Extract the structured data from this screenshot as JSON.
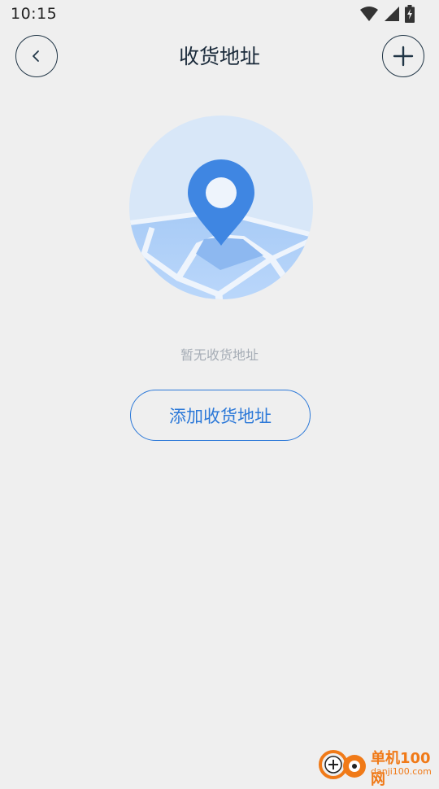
{
  "status_bar": {
    "time": "10:15",
    "icons": [
      "wifi-icon",
      "signal-icon",
      "battery-icon"
    ]
  },
  "header": {
    "title": "收货地址",
    "back_icon": "chevron-left-icon",
    "add_icon": "plus-icon"
  },
  "empty_state": {
    "illustration": "map-pin-icon",
    "message": "暂无收货地址",
    "button_label": "添加收货地址"
  },
  "watermark": {
    "main": "单机100网",
    "sub": "danji100.com"
  },
  "colors": {
    "background": "#efefef",
    "accent": "#2b78d8",
    "title": "#1a2a3a",
    "muted_text": "#a6adb6",
    "pin": "#3f86e2"
  }
}
